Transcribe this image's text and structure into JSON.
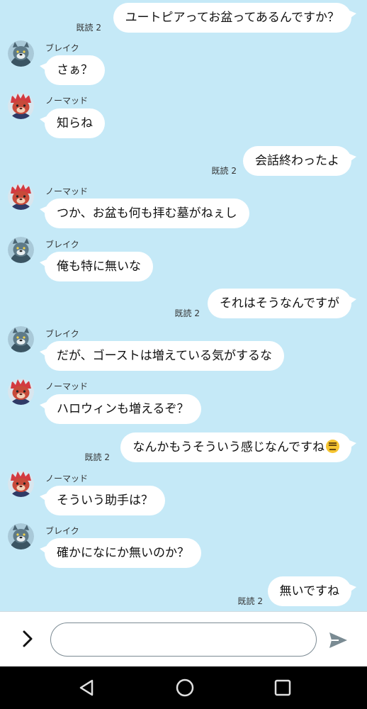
{
  "messages": [
    {
      "side": "right",
      "text": "ユートピアってお盆ってあるんですか？",
      "read": "既読 2"
    },
    {
      "side": "left",
      "avatar": "blake",
      "sender": "ブレイク",
      "text": "さぁ？"
    },
    {
      "side": "left",
      "avatar": "nomad",
      "sender": "ノーマッド",
      "text": "知らね"
    },
    {
      "side": "right",
      "text": "会話終わったよ",
      "read": "既読 2"
    },
    {
      "side": "left",
      "avatar": "nomad",
      "sender": "ノーマッド",
      "text": "つか、お盆も何も拝む墓がねぇし"
    },
    {
      "side": "left",
      "avatar": "blake",
      "sender": "ブレイク",
      "text": "俺も特に無いな"
    },
    {
      "side": "right",
      "text": "それはそうなんですが",
      "read": "既読 2"
    },
    {
      "side": "left",
      "avatar": "blake",
      "sender": "ブレイク",
      "text": "だが、ゴーストは増えている気がするな"
    },
    {
      "side": "left",
      "avatar": "nomad",
      "sender": "ノーマッド",
      "text": "ハロウィンも増えるぞ？"
    },
    {
      "side": "right",
      "text": "なんかもうそういう感じなんですね",
      "emoji": "expressionless-face",
      "read": "既読 2"
    },
    {
      "side": "left",
      "avatar": "nomad",
      "sender": "ノーマッド",
      "text": "そういう助手は？"
    },
    {
      "side": "left",
      "avatar": "blake",
      "sender": "ブレイク",
      "text": "確かになにか無いのか？"
    },
    {
      "side": "right",
      "text": "無いですね",
      "read": "既読 2"
    }
  ],
  "input": {
    "value": "",
    "placeholder": ""
  },
  "icons": {
    "expand": "chevron-right-icon",
    "send": "send-icon",
    "nav_back": "back-triangle-icon",
    "nav_home": "home-circle-icon",
    "nav_recent": "recent-square-icon"
  },
  "colors": {
    "background": "#c5e9f7",
    "bubble": "#ffffff",
    "blake_fur": "#4e6a78",
    "nomad_hair": "#d33a40"
  }
}
